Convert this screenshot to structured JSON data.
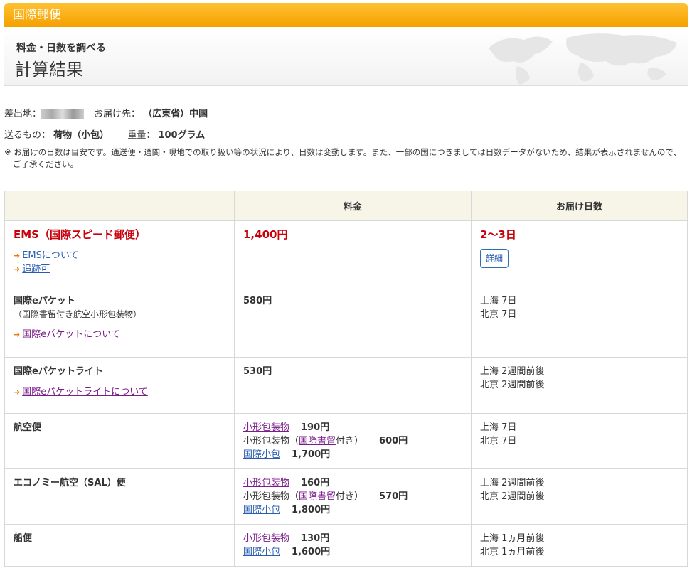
{
  "titlebar": {
    "title": "国際郵便"
  },
  "header": {
    "subtitle": "料金・日数を調べる",
    "title": "計算結果"
  },
  "info": {
    "origin_label": "差出地：",
    "dest_label": "お届け先：",
    "dest_value": "（広東省）中国",
    "item_label": "送るもの：",
    "item_value": "荷物（小包）",
    "weight_label": "重量：",
    "weight_value": "100グラム"
  },
  "note": "※ お届けの日数は目安です。通送便・通関・現地での取り扱い等の状況により、日数は変動します。また、一部の国につきましては日数データがないため、結果が表示されませんので、ご了承ください。",
  "table": {
    "headers": [
      "",
      "料金",
      "お届け日数"
    ],
    "ems": {
      "name": "EMS（国際スピード郵便）",
      "link1": "EMSについて",
      "link2": "追跡可",
      "price": "1,400円",
      "days": "2〜3日",
      "detail": "詳細"
    },
    "epacket": {
      "name": "国際eパケット",
      "desc": "（国際書留付き航空小形包装物）",
      "link": "国際eパケットについて",
      "price": "580円",
      "days1": "上海 7日",
      "days2": "北京 7日"
    },
    "epacket_lite": {
      "name": "国際eパケットライト",
      "link": "国際eパケットライトについて",
      "price": "530円",
      "days1": "上海 2週間前後",
      "days2": "北京 2週間前後"
    },
    "air": {
      "name": "航空便",
      "p1_label": "小形包装物",
      "p1_price": "190円",
      "p2_pre": "小形包装物（",
      "p2_link": "国際書留",
      "p2_post": "付き）",
      "p2_price": "600円",
      "p3_label": "国際小包",
      "p3_price": "1,700円",
      "days1": "上海 7日",
      "days2": "北京 7日"
    },
    "sal": {
      "name": "エコノミー航空（SAL）便",
      "p1_label": "小形包装物",
      "p1_price": "160円",
      "p2_pre": "小形包装物（",
      "p2_link": "国際書留",
      "p2_post": "付き）",
      "p2_price": "570円",
      "p3_label": "国際小包",
      "p3_price": "1,800円",
      "days1": "上海 2週間前後",
      "days2": "北京 2週間前後"
    },
    "ship": {
      "name": "船便",
      "p1_label": "小形包装物",
      "p1_price": "130円",
      "p3_label": "国際小包",
      "p3_price": "1,600円",
      "days1": "上海 1ヵ月前後",
      "days2": "北京 1ヵ月前後"
    }
  }
}
